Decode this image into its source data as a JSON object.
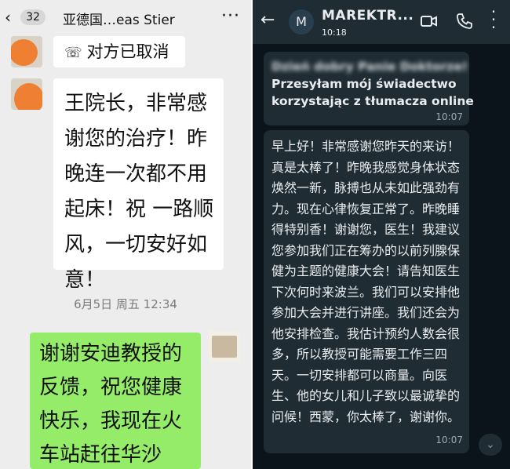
{
  "wechat": {
    "unread_count": "32",
    "title": "亚德国…eas Stier",
    "system_notice": "对方已取消",
    "message_in": "王院长，非常感谢您的治疗！昨晚连一次都不用起床！祝 一路顺风，一切安好如意！",
    "timestamp": "6月5日 周五 12:34",
    "message_out": "谢谢安迪教授的反馈，祝您健康快乐，我现在火车站赶往华沙"
  },
  "whatsapp": {
    "contact_name": "MAREKTR...",
    "avatar_letter": "M",
    "status_time": "10:18",
    "message1_lines": [
      "Dzień dobry Panie Doktorze!",
      "Przesyłam mój świadectwo",
      "korzystając z tłumacza online"
    ],
    "message1_time": "10:07",
    "message2": "早上好！非常感谢您昨天的来访！真是太棒了！昨晚我感觉身体状态焕然一新，脉搏也从未如此强劲有力。现在心律恢复正常了。昨晚睡得特别香！谢谢您，医生！我建议您参加我们正在筹办的以前列腺保健为主题的健康大会！请告知医生下次何时来波兰。我们可以安排他参加大会并进行讲座。我们还会为他安排检查。我估计预约人数会很多，所以教授可能需要工作三四天。一切安排都可以商量。向医生、他的女儿和儿子致以最诚挚的问候！西蒙，你太棒了，谢谢你。",
    "message2_time": "10:07"
  }
}
